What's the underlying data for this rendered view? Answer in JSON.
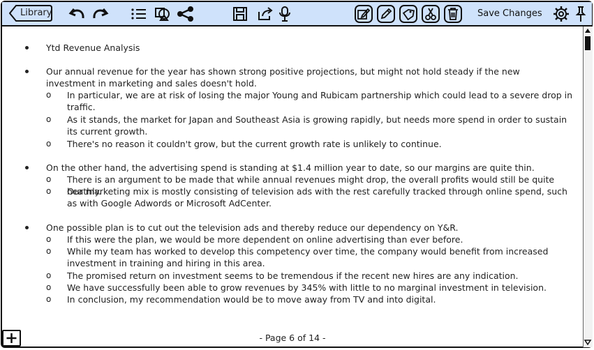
{
  "toolbar": {
    "library_label": "Library",
    "save_label": "Save Changes"
  },
  "content": {
    "bullets": [
      {
        "text": "Ytd Revenue Analysis",
        "subs": []
      },
      {
        "text": "Our annual revenue for the year has shown strong positive projections, but might not hold steady if the new investment in marketing and sales doesn't hold.",
        "subs": [
          "In particular, we are at risk of losing the major Young and Rubicam partnership which could lead to a severe drop in traffic.",
          "As it stands, the market for Japan and Southeast Asia is growing rapidly, but needs more spend in order to sustain its current growth.",
          "There's no reason it couldn't grow, but the current growth rate is unlikely to continue."
        ]
      },
      {
        "text": "On the other hand, the advertising spend is standing at $1.4 million year to date, so our margins are quite thin.",
        "subs": [
          "There is an argument to be made that while annual revenues might drop, the overall profits would still be quite heathly.",
          "Our marketing mix is mostly consisting of television ads with the rest carefully tracked through online spend, such as with Google Adwords or Microsoft AdCenter."
        ]
      },
      {
        "text": "One possible plan is to cut out the television ads and thereby reduce our dependency on Y&R.",
        "subs": [
          "If this were the plan, we would be more dependent on online advertising than ever before.",
          "While my team has worked to develop this competency over time, the company would benefit from increased investment in training and hiring in this area.",
          "The promised return on investment seems to be tremendous if the recent new hires are any indication.",
          "We have successfully been able to grow revenues by 345% with little to no marginal investment in television.",
          "In conclusion, my recommendation would be to move away from TV and into digital."
        ]
      }
    ],
    "sub_marker": "o"
  },
  "footer": {
    "page_label": "- Page 6 of 14 -"
  }
}
